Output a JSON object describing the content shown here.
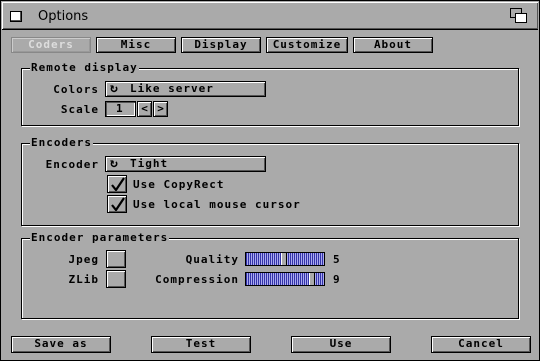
{
  "window": {
    "title": "Options"
  },
  "tabs": [
    {
      "label": "Coders",
      "enabled": false
    },
    {
      "label": "Misc",
      "enabled": true
    },
    {
      "label": "Display",
      "enabled": true
    },
    {
      "label": "Customize",
      "enabled": true
    },
    {
      "label": "About",
      "enabled": true
    }
  ],
  "remote_display": {
    "title": "Remote display",
    "colors_label": "Colors",
    "colors_value": "Like server",
    "scale_label": "Scale",
    "scale_value": "1",
    "scale_dec": "<",
    "scale_inc": ">"
  },
  "encoders": {
    "title": "Encoders",
    "encoder_label": "Encoder",
    "encoder_value": "Tight",
    "copyrect_label": "Use CopyRect",
    "copyrect_checked": true,
    "mouse_label": "Use local mouse cursor",
    "mouse_checked": true
  },
  "encoder_params": {
    "title": "Encoder parameters",
    "jpeg_label": "Jpeg",
    "jpeg_checked": false,
    "zlib_label": "ZLib",
    "zlib_checked": false,
    "quality_label": "Quality",
    "quality_value": "5",
    "quality_fraction": 0.5,
    "compression_label": "Compression",
    "compression_value": "9",
    "compression_fraction": 0.9
  },
  "footer": {
    "save_as": "Save as",
    "test": "Test",
    "use": "Use",
    "cancel": "Cancel"
  },
  "icons": {
    "close": "close-gadget-icon",
    "depth": "depth-gadget-icon",
    "cycle": "cycle-icon",
    "check": "checkmark-icon"
  }
}
